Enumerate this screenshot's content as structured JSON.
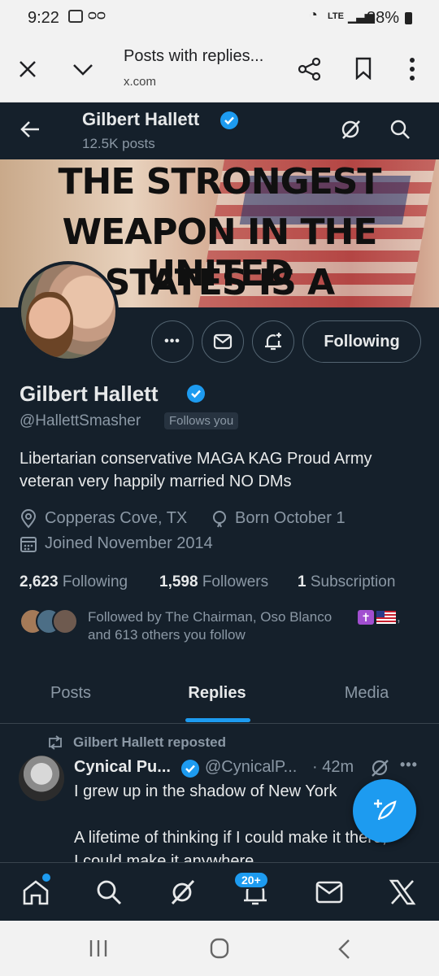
{
  "statusbar": {
    "time": "9:22",
    "battery": "88%",
    "net": "LTE"
  },
  "browser": {
    "title": "Posts with replies...",
    "url": "x.com"
  },
  "header": {
    "name": "Gilbert Hallett",
    "posts": "12.5K posts"
  },
  "banner": {
    "line1": "THE STRONGEST",
    "line2": "WEAPON IN THE UNITED",
    "line3": "STATES IS A PATRIOTIC"
  },
  "actions": {
    "more": "•••",
    "following": "Following"
  },
  "profile": {
    "name": "Gilbert Hallett",
    "handle": "@HallettSmasher",
    "follows_you": "Follows you",
    "bio": "Libertarian conservative MAGA KAG Proud Army veteran very happily married NO DMs",
    "location": "Copperas Cove, TX",
    "born": "Born October 1",
    "joined": "Joined November 2014",
    "following_count": "2,623",
    "following_label": "Following",
    "followers_count": "1,598",
    "followers_label": "Followers",
    "subs_count": "1",
    "subs_label": "Subscription",
    "followed_by_line1": "Followed by The Chairman, Oso Blanco",
    "followed_by_line2": "and 613 others you follow"
  },
  "tabs": [
    {
      "label": "Posts"
    },
    {
      "label": "Replies"
    },
    {
      "label": "Media"
    }
  ],
  "post": {
    "repost_label": "Gilbert Hallett reposted",
    "author": "Cynical Pu...",
    "handle": "@CynicalP...",
    "time": "· 42m",
    "line1": "I grew up in the shadow of New York",
    "line2": "A lifetime of thinking if I could make it there,",
    "line3": "I could make it anywhere"
  },
  "nav": {
    "notif_badge": "20+"
  },
  "colors": {
    "bg": "#15202b",
    "accent": "#1d9bf0",
    "muted": "#8b98a5",
    "text": "#e7e9ea"
  }
}
